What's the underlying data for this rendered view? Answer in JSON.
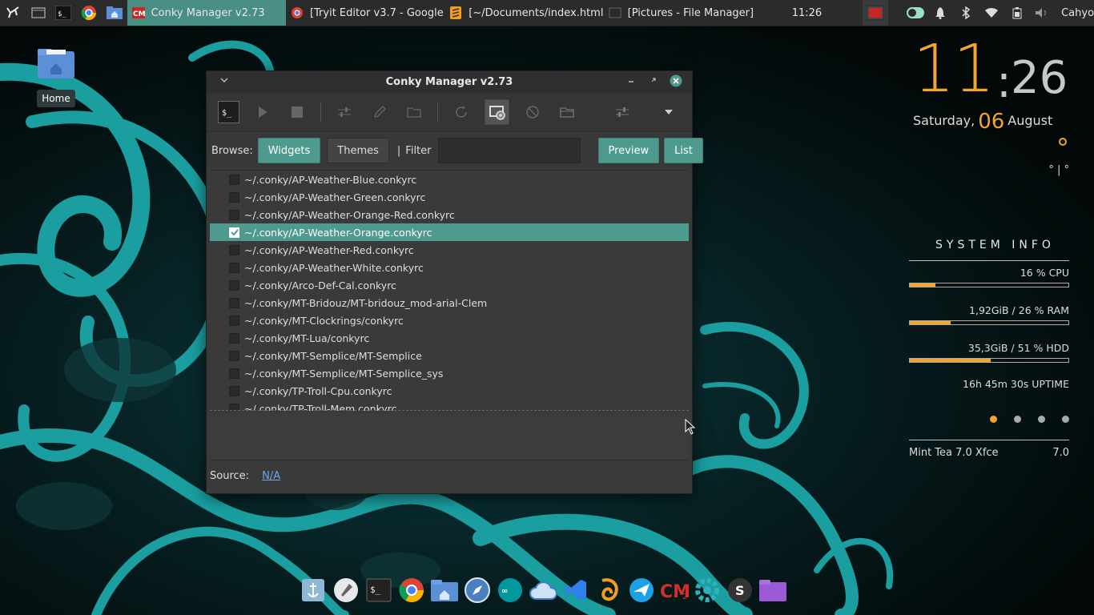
{
  "top_panel": {
    "tasks": [
      {
        "label": "Conky Manager v2.73",
        "active": true
      },
      {
        "label": "[Tryit Editor v3.7 - Google ...",
        "active": false
      },
      {
        "label": "[~/Documents/index.html ...",
        "active": false
      },
      {
        "label": "[Pictures - File Manager]",
        "active": false
      }
    ],
    "clock": "11:26",
    "user": "Cahyo"
  },
  "desktop": {
    "home_label": "Home"
  },
  "conky_manager": {
    "title": "Conky Manager v2.73",
    "browse_label": "Browse:",
    "widgets_button": "Widgets",
    "themes_button": "Themes",
    "separator": "|",
    "filter_label": "Filter",
    "filter_value": "",
    "preview_button": "Preview",
    "list_button": "List",
    "items": [
      {
        "path": "~/.conky/AP-Weather-Blue.conkyrc",
        "checked": false
      },
      {
        "path": "~/.conky/AP-Weather-Green.conkyrc",
        "checked": false
      },
      {
        "path": "~/.conky/AP-Weather-Orange-Red.conkyrc",
        "checked": false
      },
      {
        "path": "~/.conky/AP-Weather-Orange.conkyrc",
        "checked": true
      },
      {
        "path": "~/.conky/AP-Weather-Red.conkyrc",
        "checked": false
      },
      {
        "path": "~/.conky/AP-Weather-White.conkyrc",
        "checked": false
      },
      {
        "path": "~/.conky/Arco-Def-Cal.conkyrc",
        "checked": false
      },
      {
        "path": "~/.conky/MT-Bridouz/MT-bridouz_mod-arial-Clem",
        "checked": false
      },
      {
        "path": "~/.conky/MT-Clockrings/conkyrc",
        "checked": false
      },
      {
        "path": "~/.conky/MT-Lua/conkyrc",
        "checked": false
      },
      {
        "path": "~/.conky/MT-Semplice/MT-Semplice",
        "checked": false
      },
      {
        "path": "~/.conky/MT-Semplice/MT-Semplice_sys",
        "checked": false
      },
      {
        "path": "~/.conky/TP-Troll-Cpu.conkyrc",
        "checked": false
      },
      {
        "path": "~/.conky/TP-Troll-Mem.conkyrc",
        "checked": false
      }
    ],
    "source_label": "Source:",
    "source_value": "N/A",
    "accent_color": "#4f9a8e"
  },
  "conky_widget": {
    "hour": "11",
    "colon": ":",
    "minute": "26",
    "weekday": "Saturday,",
    "day": "06",
    "month": "August",
    "weather_glyph": "° | °",
    "sysinfo_title": "SYSTEM INFO",
    "cpu_text": "16 % CPU",
    "cpu_percent": 16,
    "ram_text": "1,92GiB / 26 % RAM",
    "ram_percent": 26,
    "hdd_text": "35,3GiB / 51 % HDD",
    "hdd_percent": 51,
    "uptime_text": "16h 45m 30s UPTIME",
    "distro_name": "Mint Tea 7.0 Xfce",
    "distro_version": "7.0",
    "accent_color": "#f3a42e"
  },
  "dock": {
    "icons": [
      "anchor-icon",
      "rocket-icon",
      "terminal-icon",
      "chrome-icon",
      "home-folder-icon",
      "browser-compass-icon",
      "arduino-icon",
      "cloud-sync-icon",
      "vscode-icon",
      "sublime-icon",
      "bird-icon",
      "conky-manager-icon",
      "settings-gear-icon",
      "s-app-icon",
      "folder-icon"
    ]
  }
}
